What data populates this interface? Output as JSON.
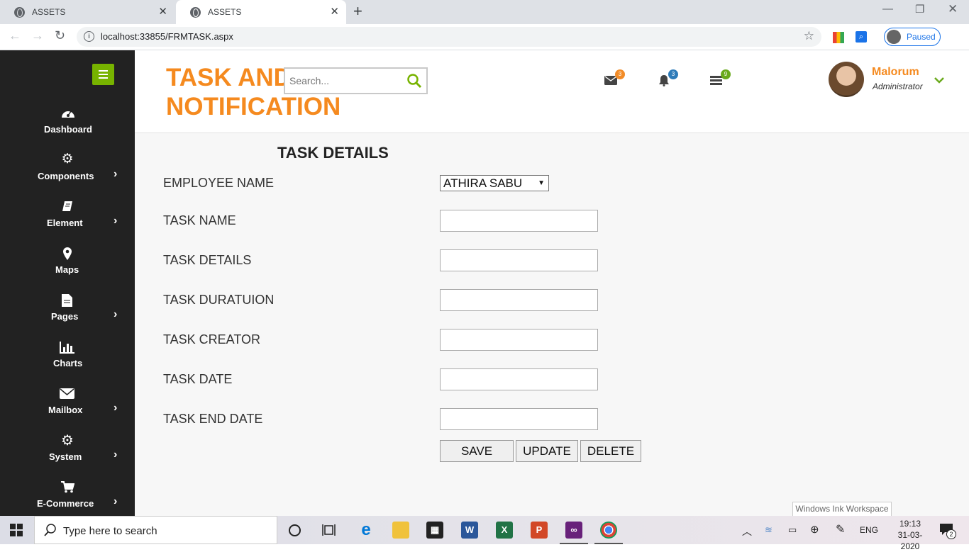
{
  "browser": {
    "tabs": [
      {
        "title": "ASSETS"
      },
      {
        "title": "ASSETS"
      }
    ],
    "url": "localhost:33855/FRMTASK.aspx",
    "profile_status": "Paused"
  },
  "sidebar": {
    "items": [
      {
        "label": "Dashboard",
        "icon": "dashboard-icon",
        "has_submenu": false
      },
      {
        "label": "Components",
        "icon": "cogs-icon",
        "has_submenu": true
      },
      {
        "label": "Element",
        "icon": "book-icon",
        "has_submenu": true
      },
      {
        "label": "Maps",
        "icon": "map-marker-icon",
        "has_submenu": false
      },
      {
        "label": "Pages",
        "icon": "file-icon",
        "has_submenu": true
      },
      {
        "label": "Charts",
        "icon": "bar-chart-icon",
        "has_submenu": false
      },
      {
        "label": "Mailbox",
        "icon": "envelope-icon",
        "has_submenu": true
      },
      {
        "label": "System",
        "icon": "gear-icon",
        "has_submenu": true
      },
      {
        "label": "E-Commerce",
        "icon": "cart-icon",
        "has_submenu": true
      }
    ]
  },
  "header": {
    "title_line1": "TASK AND",
    "title_line2": "NOTIFICATION",
    "search_placeholder": "Search...",
    "badges": {
      "mail": "3",
      "bell": "3",
      "tasks": "9"
    },
    "user": {
      "name": "Malorum",
      "role": "Administrator"
    },
    "colors": {
      "accent": "#f58a1f",
      "green": "#77b300",
      "badge_orange": "#f28c28",
      "badge_blue": "#2d7bb9",
      "badge_green": "#6aaa1c"
    }
  },
  "form": {
    "title": "TASK DETAILS",
    "employee_label": "EMPLOYEE NAME",
    "employee_value": "ATHIRA SABU",
    "fields": [
      {
        "label": "TASK NAME",
        "value": ""
      },
      {
        "label": "TASK DETAILS",
        "value": ""
      },
      {
        "label": "TASK DURATUION",
        "value": ""
      },
      {
        "label": "TASK CREATOR",
        "value": ""
      },
      {
        "label": "TASK DATE",
        "value": ""
      },
      {
        "label": "TASK END DATE",
        "value": ""
      }
    ],
    "buttons": {
      "save": "SAVE",
      "update": "UPDATE",
      "delete": "DELETE"
    }
  },
  "ink_tooltip": "Windows Ink Workspace",
  "taskbar": {
    "search_placeholder": "Type here to search",
    "language": "ENG",
    "time": "19:13",
    "date": "31-03-2020",
    "notification_count": "2"
  }
}
